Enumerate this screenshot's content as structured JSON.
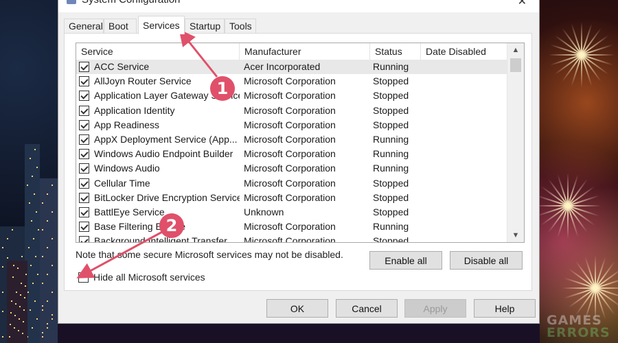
{
  "window": {
    "title": "System Configuration"
  },
  "tabs": [
    {
      "label": "General",
      "active": false
    },
    {
      "label": "Boot",
      "active": false
    },
    {
      "label": "Services",
      "active": true
    },
    {
      "label": "Startup",
      "active": false
    },
    {
      "label": "Tools",
      "active": false
    }
  ],
  "columns": [
    "Service",
    "Manufacturer",
    "Status",
    "Date Disabled"
  ],
  "services": [
    {
      "service": "ACC Service",
      "manufacturer": "Acer Incorporated",
      "status": "Running",
      "checked": true
    },
    {
      "service": "AllJoyn Router Service",
      "manufacturer": "Microsoft Corporation",
      "status": "Stopped",
      "checked": true
    },
    {
      "service": "Application Layer Gateway Service",
      "manufacturer": "Microsoft Corporation",
      "status": "Stopped",
      "checked": true
    },
    {
      "service": "Application Identity",
      "manufacturer": "Microsoft Corporation",
      "status": "Stopped",
      "checked": true
    },
    {
      "service": "App Readiness",
      "manufacturer": "Microsoft Corporation",
      "status": "Stopped",
      "checked": true
    },
    {
      "service": "AppX Deployment Service (App...",
      "manufacturer": "Microsoft Corporation",
      "status": "Running",
      "checked": true
    },
    {
      "service": "Windows Audio Endpoint Builder",
      "manufacturer": "Microsoft Corporation",
      "status": "Running",
      "checked": true
    },
    {
      "service": "Windows Audio",
      "manufacturer": "Microsoft Corporation",
      "status": "Running",
      "checked": true
    },
    {
      "service": "Cellular Time",
      "manufacturer": "Microsoft Corporation",
      "status": "Stopped",
      "checked": true
    },
    {
      "service": "BitLocker Drive Encryption Service",
      "manufacturer": "Microsoft Corporation",
      "status": "Stopped",
      "checked": true
    },
    {
      "service": "BattlEye Service",
      "manufacturer": "Unknown",
      "status": "Stopped",
      "checked": true
    },
    {
      "service": "Base Filtering Engine",
      "manufacturer": "Microsoft Corporation",
      "status": "Running",
      "checked": true
    },
    {
      "service": "Background Intelligent Transfer...",
      "manufacturer": "Microsoft Corporation",
      "status": "Stopped",
      "checked": true
    }
  ],
  "note": "Note that some secure Microsoft services may not be disabled.",
  "buttons": {
    "enable_all": "Enable all",
    "disable_all": "Disable all",
    "ok": "OK",
    "cancel": "Cancel",
    "apply": "Apply",
    "help": "Help"
  },
  "hide_ms": {
    "label": "Hide all Microsoft services",
    "checked": false
  },
  "annotations": [
    {
      "number": "1"
    },
    {
      "number": "2"
    }
  ],
  "watermark": {
    "line1": "GAMES",
    "line2": "ERRORS"
  },
  "colors": {
    "annotation": "#e0506a",
    "selected_row": "#e8e8e8"
  }
}
